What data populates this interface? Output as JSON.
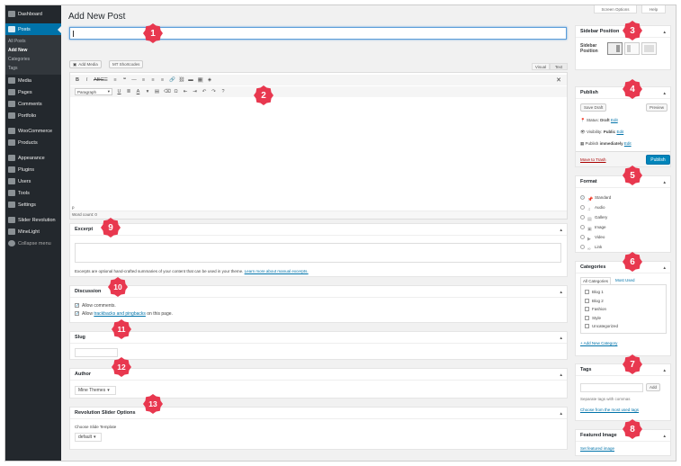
{
  "page": {
    "title": "Add New Post",
    "screen_options": "Screen Options",
    "help": "Help"
  },
  "sidebar": {
    "items": [
      {
        "label": "Dashboard",
        "icon": "dashboard-icon"
      },
      {
        "label": "Posts",
        "icon": "pin-icon"
      },
      {
        "label": "Media",
        "icon": "media-icon"
      },
      {
        "label": "Pages",
        "icon": "pages-icon"
      },
      {
        "label": "Comments",
        "icon": "comments-icon"
      },
      {
        "label": "Portfolio",
        "icon": "portfolio-icon"
      },
      {
        "label": "WooCommerce",
        "icon": "woocommerce-icon"
      },
      {
        "label": "Products",
        "icon": "products-icon"
      },
      {
        "label": "Appearance",
        "icon": "appearance-icon"
      },
      {
        "label": "Plugins",
        "icon": "plugins-icon"
      },
      {
        "label": "Users",
        "icon": "users-icon"
      },
      {
        "label": "Tools",
        "icon": "tools-icon"
      },
      {
        "label": "Settings",
        "icon": "settings-icon"
      },
      {
        "label": "Slider Revolution",
        "icon": "slider-icon"
      },
      {
        "label": "MineLight",
        "icon": "minelight-icon"
      },
      {
        "label": "Collapse menu",
        "icon": "collapse-icon"
      }
    ],
    "posts_sub": [
      "All Posts",
      "Add New",
      "Categories",
      "Tags"
    ]
  },
  "editor": {
    "add_media": "Add Media",
    "shortcodes": "MT Shortcodes",
    "tab_visual": "Visual",
    "tab_text": "Text",
    "paragraph": "Paragraph",
    "path": "p",
    "word_count": "Word count: 0"
  },
  "excerpt": {
    "title": "Excerpt",
    "help": "Excerpts are optional hand-crafted summaries of your content that can be used in your theme.",
    "link": "Learn more about manual excerpts."
  },
  "discussion": {
    "title": "Discussion",
    "allow_comments": "Allow comments.",
    "allow_prefix": "Allow",
    "trackbacks_link": "trackbacks and pingbacks",
    "allow_suffix": "on this page."
  },
  "slug": {
    "title": "Slug"
  },
  "author": {
    "title": "Author",
    "value": "Mine Themes"
  },
  "revslider": {
    "title": "Revolution Slider Options",
    "label": "Choose Slide Template",
    "value": "default"
  },
  "sidebar_position": {
    "title": "Sidebar Position",
    "label_line1": "Sidebar",
    "label_line2": "Position"
  },
  "publish": {
    "title": "Publish",
    "save_draft": "Save Draft",
    "preview": "Preview",
    "status_label": "Status:",
    "status_value": "Draft",
    "edit": "Edit",
    "visibility_label": "Visibility:",
    "visibility_value": "Public",
    "publish_label": "Publish",
    "publish_value": "immediately",
    "trash": "Move to Trash",
    "publish_btn": "Publish"
  },
  "format": {
    "title": "Format",
    "options": [
      "Standard",
      "Audio",
      "Gallery",
      "Image",
      "Video",
      "Link"
    ],
    "selected": "Standard"
  },
  "categories": {
    "title": "Categories",
    "tab_all": "All Categories",
    "tab_most": "Most Used",
    "items": [
      "Blog 1",
      "Blog 2",
      "Fashion",
      "Style",
      "Uncategorized"
    ],
    "add_new": "+ Add New Category"
  },
  "tags": {
    "title": "Tags",
    "add": "Add",
    "help": "Separate tags with commas",
    "choose": "Choose from the most used tags"
  },
  "featured": {
    "title": "Featured Image",
    "set": "Set featured image"
  },
  "callouts": [
    "1",
    "2",
    "3",
    "4",
    "5",
    "6",
    "7",
    "8",
    "9",
    "10",
    "11",
    "12",
    "13"
  ],
  "colors": {
    "sidebar": "#23282d",
    "accent": "#0073aa",
    "callout": "#e8384f",
    "publish": "#0085ba"
  }
}
